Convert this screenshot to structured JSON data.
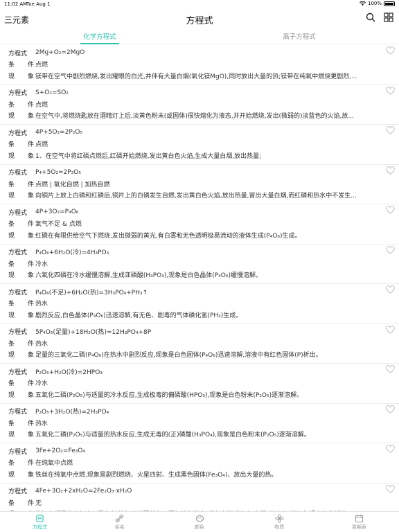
{
  "status_bar": {
    "time": "11:02 AM",
    "date": "Tue Aug 1",
    "battery": "100%"
  },
  "nav": {
    "left": "三元素",
    "title": "方程式",
    "search_icon": "search-icon",
    "grid_icon": "grid-icon"
  },
  "tabs": [
    {
      "label": "化学方程式",
      "active": true
    },
    {
      "label": "离子方程式",
      "active": false
    }
  ],
  "labels": {
    "equation": "方程式",
    "condition": "条件",
    "phenomenon": "现象"
  },
  "entries": [
    {
      "eq": "2Mg+O₂=2MgO",
      "cond": "点燃",
      "phen": "镁带在空气中剧烈燃烧,发出耀眼的白光,并伴有大量白烟(氧化镁MgO),同时放出大量的热;镁带在纯氧中燃烧更剧烈,..."
    },
    {
      "eq": "S+O₂=SO₂",
      "cond": "点燃",
      "phen": "在空气中,将燃烧匙放在酒精灯上后,淡黄色粉末(或固体)很快熔化为液态,并开始燃烧,发出(微弱的)淡蓝色的火焰,放..."
    },
    {
      "eq": "4P+5O₂=2P₂O₅",
      "cond": "点燃",
      "phen": "1、在空气中将红磷点燃后,红磷开始燃烧,发出黄白色火焰,生成大量白烟,放出热量;"
    },
    {
      "eq": "P₄+5O₂=2P₂O₅",
      "cond": "点燃 | 氧化自燃 | 加热自燃",
      "phen": "向铜片上放上白磷和红磷后,铜片上的白磷发生自燃,发出黄白色火焰,放出热量,冒出大量白烟,而红磷和热水中不发生..."
    },
    {
      "eq": "4P+3O₂=P₄O₆",
      "cond": "氧气不足 & 点燃",
      "phen": "红磷在有限供给空气下燃烧,发出微弱的黄光,有白雾和无色透明极易流动的液体生成(P₄O₆)生成。"
    },
    {
      "eq": "P₄O₆+6H₂O(冷)=4H₃PO₃",
      "cond": "冷水",
      "phen": "六氧化四磷在冷水缓慢溶解,生成亚磷酸(H₃PO₃),现象是白色晶体(P₄O₆)缓慢溶解。"
    },
    {
      "eq": "P₄O₆(不足)+6H₂O(热)=3H₃PO₄+PH₃↑",
      "cond": "热水",
      "phen": "剧烈反应,白色晶体(P₄O₆)迅速溶解,有无色、剧毒的气体磷化氢(PH₃)生成。"
    },
    {
      "eq": "5P₄O₆(足量)+18H₂O(热)=12H₃PO₄+8P",
      "cond": "热水",
      "phen": "足量的三氧化二磷(P₄O₆)在热水中剧烈反应,现象是白色固体(P₄O₆)迅速溶解,溶液中有红色固体(P)析出。"
    },
    {
      "eq": "P₂O₅+H₂O(冷)=2HPO₃",
      "cond": "冷水",
      "phen": "五氧化二磷(P₂O₅)与适量的冷水反应,生成极毒的偏磷酸(HPO₃),现象是白色粉末(P₂O₅)逐渐溶解。"
    },
    {
      "eq": "P₂O₅+3H₂O(热)=2H₃PO₄",
      "cond": "热水",
      "phen": "五氧化二磷(P₂O₅)与适量的热水反应,生成无毒的(正)磷酸(H₃PO₄),现象是白色粉末(P₂O₅)逐渐溶解。"
    },
    {
      "eq": "3Fe+2O₂=Fe₃O₄",
      "cond": "在纯氧中点燃",
      "phen": "铁丝在纯氧中点燃,现象是剧烈燃烧、火星四射、生成黑色固体(Fe₃O₄)、放出大量的热。"
    },
    {
      "eq": "4Fe+3O₂+2xH₂O=2Fe₂O₃·xH₂O",
      "cond": "无",
      "phen": "铁钉在潮湿的空气中一周左右,铁钉表面覆盖有一层红棕色粉末,盛有水的试管中,大概1天左右,铁钉靠近水面的部分..."
    }
  ],
  "bottom_tabs": [
    {
      "label": "方程式",
      "icon": "flask-icon",
      "active": true
    },
    {
      "label": "俗名",
      "icon": "link-icon",
      "active": false
    },
    {
      "label": "颜色",
      "icon": "palette-icon",
      "active": false
    },
    {
      "label": "物质",
      "icon": "atom-icon",
      "active": false
    },
    {
      "label": "周期表",
      "icon": "calendar-icon",
      "active": false
    }
  ],
  "colors": {
    "accent": "#2fc2b3"
  }
}
